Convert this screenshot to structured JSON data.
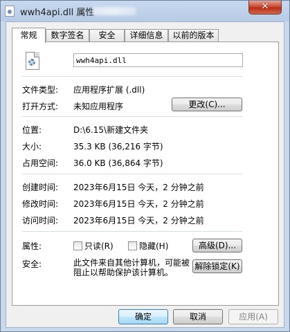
{
  "window": {
    "title": "wwh4api.dll 属性",
    "close_glyph": "✕"
  },
  "tabs": [
    {
      "label": "常规",
      "active": true
    },
    {
      "label": "数字签名",
      "active": false
    },
    {
      "label": "安全",
      "active": false
    },
    {
      "label": "详细信息",
      "active": false
    },
    {
      "label": "以前的版本",
      "active": false
    }
  ],
  "general": {
    "file_icon": "dll-file-icon",
    "file_name": "wwh4api.dll",
    "file_type_label": "文件类型:",
    "file_type_value": "应用程序扩展 (.dll)",
    "opens_with_label": "打开方式:",
    "opens_with_value": "未知应用程序",
    "change_button": "更改(C)...",
    "location_label": "位置:",
    "location_value": "D:\\6.15\\新建文件夹",
    "size_label": "大小:",
    "size_value": "35.3 KB (36,216 字节)",
    "size_on_disk_label": "占用空间:",
    "size_on_disk_value": "36.0 KB (36,864 字节)",
    "created_label": "创建时间:",
    "created_value": "2023年6月15日 今天，2 分钟之前",
    "modified_label": "修改时间:",
    "modified_value": "2023年6月15日 今天，2 分钟之前",
    "accessed_label": "访问时间:",
    "accessed_value": "2023年6月15日 今天，2 分钟之前",
    "attributes_label": "属性:",
    "readonly_label": "只读(R)",
    "readonly_checked": false,
    "hidden_label": "隐藏(H)",
    "hidden_checked": false,
    "advanced_button": "高级(D)...",
    "security_label": "安全:",
    "security_text": "此文件来自其他计算机，可能被阻止以帮助保护该计算机。",
    "unblock_button": "解除锁定(K)"
  },
  "footer": {
    "ok_button": "确定",
    "cancel_button": "取消",
    "apply_button": "应用(A)"
  },
  "colors": {
    "titlebar": "#b7cbe6",
    "close_button": "#c6432c",
    "default_button_border": "#3c7fb1"
  }
}
